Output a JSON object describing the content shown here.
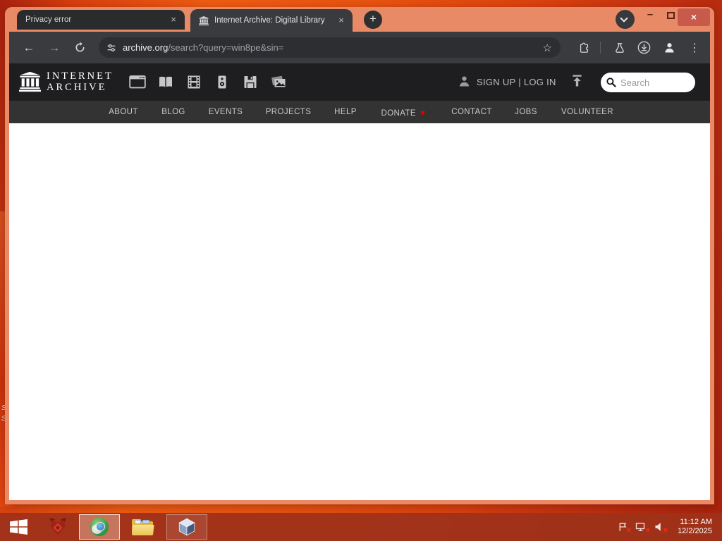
{
  "desktop": {
    "icon_label_fragments": [
      "S",
      "S"
    ]
  },
  "browser": {
    "tabs": [
      {
        "title": "Privacy error",
        "active": false
      },
      {
        "title": "Internet Archive: Digital Library",
        "active": true
      }
    ],
    "url_host": "archive.org",
    "url_path": "/search?query=win8pe&sin=",
    "glyphs": {
      "back": "←",
      "forward": "→",
      "star": "☆",
      "dots": "⋮",
      "plus": "+",
      "close": "×",
      "minimize": "–"
    }
  },
  "ia": {
    "logo_line1": "INTERNET",
    "logo_line2": "ARCHIVE",
    "media_types": [
      "web",
      "texts",
      "video",
      "audio",
      "software",
      "images"
    ],
    "signup_login": "SIGN UP | LOG IN",
    "search_placeholder": "Search",
    "donate_heart": "♥",
    "nav": [
      "ABOUT",
      "BLOG",
      "EVENTS",
      "PROJECTS",
      "HELP",
      "DONATE",
      "CONTACT",
      "JOBS",
      "VOLUNTEER"
    ]
  },
  "taskbar": {
    "clock_time": "11:12 AM",
    "clock_date": "12/2/2025",
    "tray_status": {
      "flag": "error",
      "network": "disconnected",
      "volume": "muted"
    }
  },
  "colors": {
    "titlebar_salmon": "#e98a66",
    "desktop_orange": "#e85210",
    "toolbar_dark": "#3a3b3e",
    "close_button_red": "#c75a4b",
    "ia_header_bg": "#1e1e20",
    "ia_nav_bg": "#333333",
    "donate_heart_red": "#e60000",
    "taskbar_red": "#9e321a"
  }
}
